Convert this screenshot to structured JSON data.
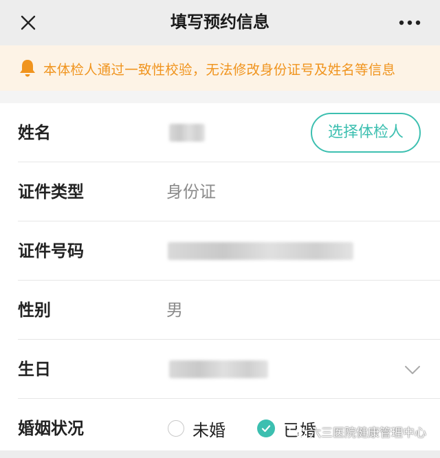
{
  "header": {
    "title": "填写预约信息",
    "close_icon": "close-icon",
    "more_icon": "more-dots-icon"
  },
  "notice": {
    "icon": "bell-icon",
    "text": "本体检人通过一致性校验，无法修改身份证号及姓名等信息",
    "color": "#f0941e"
  },
  "form": {
    "name": {
      "label": "姓名",
      "select_button": "选择体检人"
    },
    "id_type": {
      "label": "证件类型",
      "value": "身份证"
    },
    "id_number": {
      "label": "证件号码"
    },
    "gender": {
      "label": "性别",
      "value": "男"
    },
    "birthday": {
      "label": "生日"
    },
    "marital": {
      "label": "婚姻状况",
      "options": [
        {
          "label": "未婚",
          "selected": false
        },
        {
          "label": "已婚",
          "selected": true
        }
      ]
    }
  },
  "watermark": {
    "text": "六三医院健康管理中心"
  },
  "colors": {
    "accent": "#3cbfb0",
    "notice_bg": "#fdf3e6"
  }
}
